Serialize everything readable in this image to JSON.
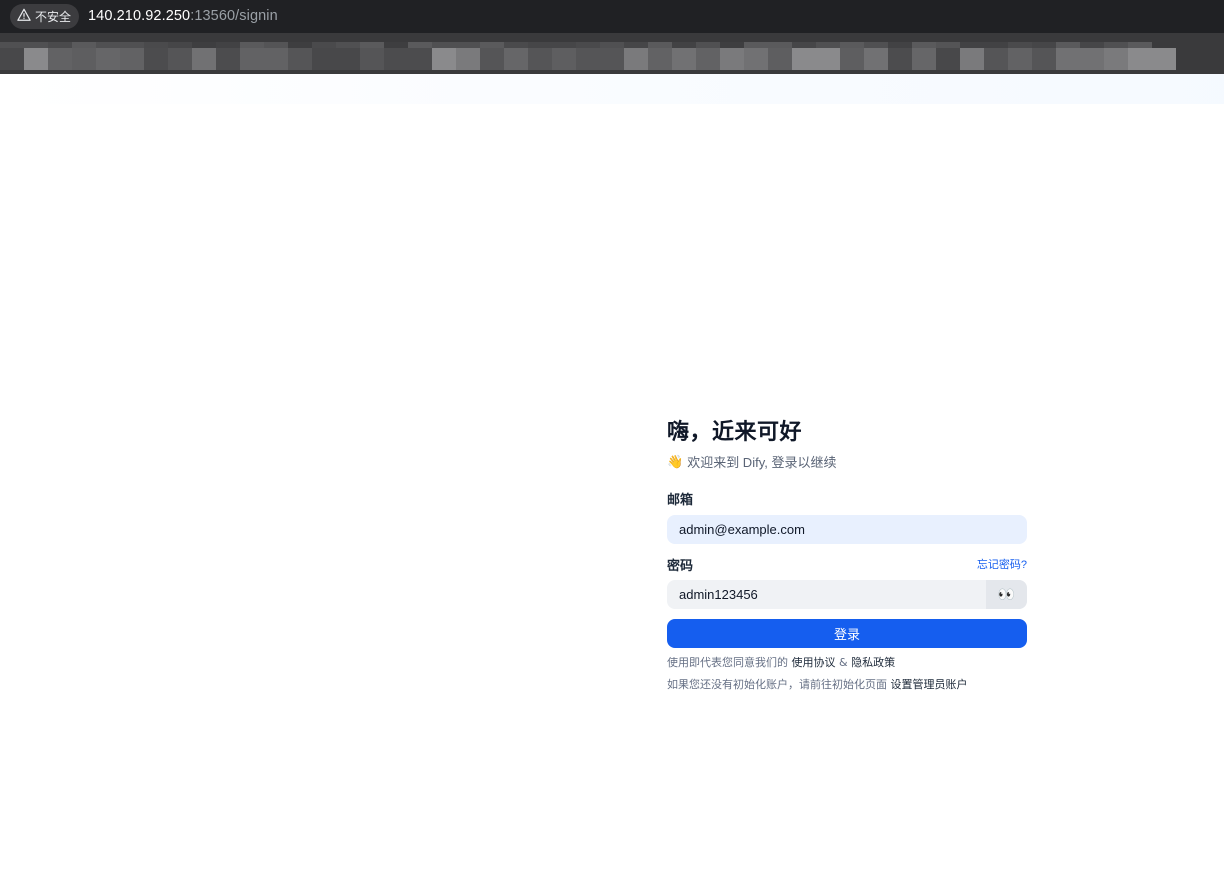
{
  "browser": {
    "security_label": "不安全",
    "url_host": "140.210.92.250",
    "url_rest": ":13560/signin"
  },
  "signin": {
    "title": "嗨，近来可好",
    "subtitle": "欢迎来到 Dify, 登录以继续",
    "email_label": "邮箱",
    "email_value": "admin@example.com",
    "password_label": "密码",
    "forgot_password": "忘记密码?",
    "password_value": "admin123456",
    "show_password_icon": "👀",
    "login_button": "登录",
    "terms_prefix": "使用即代表您同意我们的",
    "terms_link": "使用协议",
    "terms_and": "&",
    "privacy_link": "隐私政策",
    "setup_prefix": "如果您还没有初始化账户，请前往初始化页面",
    "setup_link": "设置管理员账户"
  },
  "colors": {
    "accent": "#155eef",
    "title": "#101828",
    "muted": "#667085"
  }
}
